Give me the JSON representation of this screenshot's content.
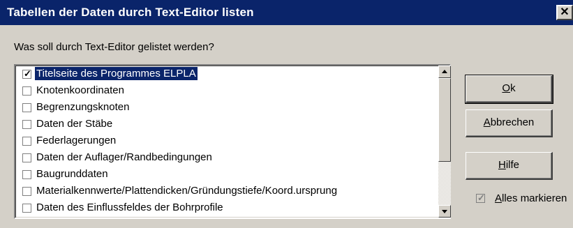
{
  "window": {
    "title": "Tabellen der Daten durch Text-Editor listen",
    "close_glyph": "✕"
  },
  "question": "Was soll durch Text-Editor gelistet werden?",
  "list": {
    "items": [
      {
        "label": "Titelseite des Programmes ELPLA",
        "checked": true,
        "selected": true
      },
      {
        "label": "Knotenkoordinaten",
        "checked": false,
        "selected": false
      },
      {
        "label": "Begrenzungsknoten",
        "checked": false,
        "selected": false
      },
      {
        "label": "Daten der Stäbe",
        "checked": false,
        "selected": false
      },
      {
        "label": "Federlagerungen",
        "checked": false,
        "selected": false
      },
      {
        "label": "Daten der Auflager/Randbedingungen",
        "checked": false,
        "selected": false
      },
      {
        "label": "Baugrunddaten",
        "checked": false,
        "selected": false
      },
      {
        "label": "Materialkennwerte/Plattendicken/Gründungstiefe/Koord.ursprung",
        "checked": false,
        "selected": false
      },
      {
        "label": "Daten des Einflussfeldes der Bohrprofile",
        "checked": false,
        "selected": false
      }
    ],
    "check_glyph": "✓"
  },
  "buttons": {
    "ok": {
      "accel": "O",
      "rest": "k"
    },
    "cancel": {
      "accel": "A",
      "rest": "bbrechen"
    },
    "help": {
      "accel": "H",
      "rest": "ilfe"
    }
  },
  "mark_all": {
    "accel": "A",
    "rest": "lles markieren",
    "checked": true,
    "disabled": true
  },
  "colors": {
    "titlebar": "#0a246a",
    "face": "#d4d0c8",
    "selection": "#0a246a"
  }
}
